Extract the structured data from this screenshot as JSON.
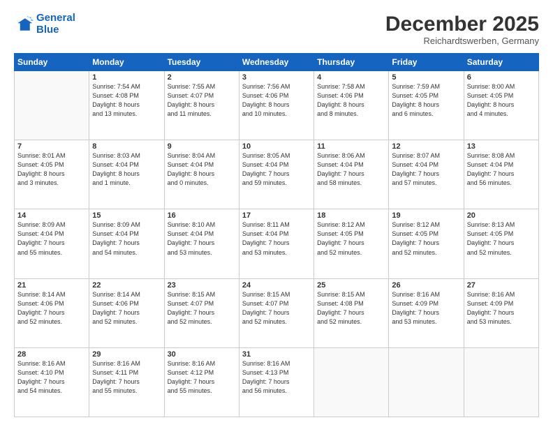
{
  "logo": {
    "line1": "General",
    "line2": "Blue"
  },
  "title": "December 2025",
  "location": "Reichardtswerben, Germany",
  "weekdays": [
    "Sunday",
    "Monday",
    "Tuesday",
    "Wednesday",
    "Thursday",
    "Friday",
    "Saturday"
  ],
  "weeks": [
    [
      {
        "day": "",
        "info": ""
      },
      {
        "day": "1",
        "info": "Sunrise: 7:54 AM\nSunset: 4:08 PM\nDaylight: 8 hours\nand 13 minutes."
      },
      {
        "day": "2",
        "info": "Sunrise: 7:55 AM\nSunset: 4:07 PM\nDaylight: 8 hours\nand 11 minutes."
      },
      {
        "day": "3",
        "info": "Sunrise: 7:56 AM\nSunset: 4:06 PM\nDaylight: 8 hours\nand 10 minutes."
      },
      {
        "day": "4",
        "info": "Sunrise: 7:58 AM\nSunset: 4:06 PM\nDaylight: 8 hours\nand 8 minutes."
      },
      {
        "day": "5",
        "info": "Sunrise: 7:59 AM\nSunset: 4:05 PM\nDaylight: 8 hours\nand 6 minutes."
      },
      {
        "day": "6",
        "info": "Sunrise: 8:00 AM\nSunset: 4:05 PM\nDaylight: 8 hours\nand 4 minutes."
      }
    ],
    [
      {
        "day": "7",
        "info": "Sunrise: 8:01 AM\nSunset: 4:05 PM\nDaylight: 8 hours\nand 3 minutes."
      },
      {
        "day": "8",
        "info": "Sunrise: 8:03 AM\nSunset: 4:04 PM\nDaylight: 8 hours\nand 1 minute."
      },
      {
        "day": "9",
        "info": "Sunrise: 8:04 AM\nSunset: 4:04 PM\nDaylight: 8 hours\nand 0 minutes."
      },
      {
        "day": "10",
        "info": "Sunrise: 8:05 AM\nSunset: 4:04 PM\nDaylight: 7 hours\nand 59 minutes."
      },
      {
        "day": "11",
        "info": "Sunrise: 8:06 AM\nSunset: 4:04 PM\nDaylight: 7 hours\nand 58 minutes."
      },
      {
        "day": "12",
        "info": "Sunrise: 8:07 AM\nSunset: 4:04 PM\nDaylight: 7 hours\nand 57 minutes."
      },
      {
        "day": "13",
        "info": "Sunrise: 8:08 AM\nSunset: 4:04 PM\nDaylight: 7 hours\nand 56 minutes."
      }
    ],
    [
      {
        "day": "14",
        "info": "Sunrise: 8:09 AM\nSunset: 4:04 PM\nDaylight: 7 hours\nand 55 minutes."
      },
      {
        "day": "15",
        "info": "Sunrise: 8:09 AM\nSunset: 4:04 PM\nDaylight: 7 hours\nand 54 minutes."
      },
      {
        "day": "16",
        "info": "Sunrise: 8:10 AM\nSunset: 4:04 PM\nDaylight: 7 hours\nand 53 minutes."
      },
      {
        "day": "17",
        "info": "Sunrise: 8:11 AM\nSunset: 4:04 PM\nDaylight: 7 hours\nand 53 minutes."
      },
      {
        "day": "18",
        "info": "Sunrise: 8:12 AM\nSunset: 4:05 PM\nDaylight: 7 hours\nand 52 minutes."
      },
      {
        "day": "19",
        "info": "Sunrise: 8:12 AM\nSunset: 4:05 PM\nDaylight: 7 hours\nand 52 minutes."
      },
      {
        "day": "20",
        "info": "Sunrise: 8:13 AM\nSunset: 4:05 PM\nDaylight: 7 hours\nand 52 minutes."
      }
    ],
    [
      {
        "day": "21",
        "info": "Sunrise: 8:14 AM\nSunset: 4:06 PM\nDaylight: 7 hours\nand 52 minutes."
      },
      {
        "day": "22",
        "info": "Sunrise: 8:14 AM\nSunset: 4:06 PM\nDaylight: 7 hours\nand 52 minutes."
      },
      {
        "day": "23",
        "info": "Sunrise: 8:15 AM\nSunset: 4:07 PM\nDaylight: 7 hours\nand 52 minutes."
      },
      {
        "day": "24",
        "info": "Sunrise: 8:15 AM\nSunset: 4:07 PM\nDaylight: 7 hours\nand 52 minutes."
      },
      {
        "day": "25",
        "info": "Sunrise: 8:15 AM\nSunset: 4:08 PM\nDaylight: 7 hours\nand 52 minutes."
      },
      {
        "day": "26",
        "info": "Sunrise: 8:16 AM\nSunset: 4:09 PM\nDaylight: 7 hours\nand 53 minutes."
      },
      {
        "day": "27",
        "info": "Sunrise: 8:16 AM\nSunset: 4:09 PM\nDaylight: 7 hours\nand 53 minutes."
      }
    ],
    [
      {
        "day": "28",
        "info": "Sunrise: 8:16 AM\nSunset: 4:10 PM\nDaylight: 7 hours\nand 54 minutes."
      },
      {
        "day": "29",
        "info": "Sunrise: 8:16 AM\nSunset: 4:11 PM\nDaylight: 7 hours\nand 55 minutes."
      },
      {
        "day": "30",
        "info": "Sunrise: 8:16 AM\nSunset: 4:12 PM\nDaylight: 7 hours\nand 55 minutes."
      },
      {
        "day": "31",
        "info": "Sunrise: 8:16 AM\nSunset: 4:13 PM\nDaylight: 7 hours\nand 56 minutes."
      },
      {
        "day": "",
        "info": ""
      },
      {
        "day": "",
        "info": ""
      },
      {
        "day": "",
        "info": ""
      }
    ]
  ]
}
